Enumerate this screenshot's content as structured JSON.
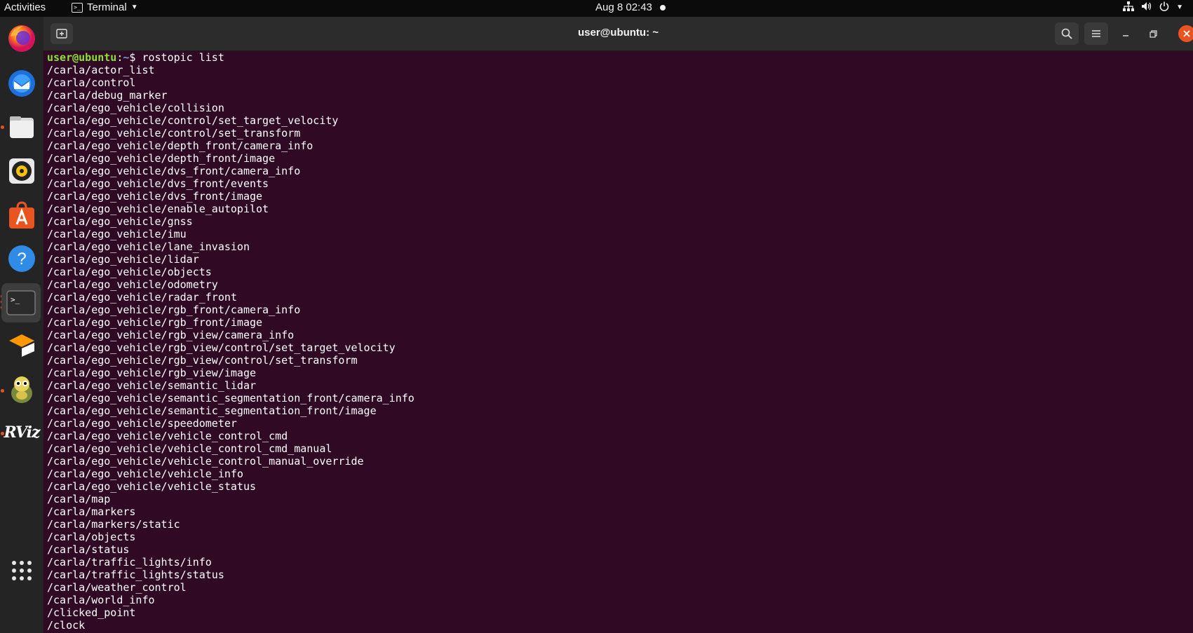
{
  "topbar": {
    "activities": "Activities",
    "app_name": "Terminal",
    "clock": "Aug 8  02:43"
  },
  "dock": {
    "apps": [
      "firefox",
      "thunderbird",
      "files",
      "rhythmbox",
      "app-center",
      "help",
      "terminal",
      "sublime-text",
      "ros-turtle",
      "rviz",
      "show-applications"
    ],
    "rviz_label": "RViz"
  },
  "window": {
    "title": "user@ubuntu: ~"
  },
  "terminal": {
    "prompt_user": "user@ubuntu",
    "prompt_sep": ":",
    "prompt_path": "~",
    "prompt_symbol": "$ ",
    "command": "rostopic list",
    "output": [
      "/carla/actor_list",
      "/carla/control",
      "/carla/debug_marker",
      "/carla/ego_vehicle/collision",
      "/carla/ego_vehicle/control/set_target_velocity",
      "/carla/ego_vehicle/control/set_transform",
      "/carla/ego_vehicle/depth_front/camera_info",
      "/carla/ego_vehicle/depth_front/image",
      "/carla/ego_vehicle/dvs_front/camera_info",
      "/carla/ego_vehicle/dvs_front/events",
      "/carla/ego_vehicle/dvs_front/image",
      "/carla/ego_vehicle/enable_autopilot",
      "/carla/ego_vehicle/gnss",
      "/carla/ego_vehicle/imu",
      "/carla/ego_vehicle/lane_invasion",
      "/carla/ego_vehicle/lidar",
      "/carla/ego_vehicle/objects",
      "/carla/ego_vehicle/odometry",
      "/carla/ego_vehicle/radar_front",
      "/carla/ego_vehicle/rgb_front/camera_info",
      "/carla/ego_vehicle/rgb_front/image",
      "/carla/ego_vehicle/rgb_view/camera_info",
      "/carla/ego_vehicle/rgb_view/control/set_target_velocity",
      "/carla/ego_vehicle/rgb_view/control/set_transform",
      "/carla/ego_vehicle/rgb_view/image",
      "/carla/ego_vehicle/semantic_lidar",
      "/carla/ego_vehicle/semantic_segmentation_front/camera_info",
      "/carla/ego_vehicle/semantic_segmentation_front/image",
      "/carla/ego_vehicle/speedometer",
      "/carla/ego_vehicle/vehicle_control_cmd",
      "/carla/ego_vehicle/vehicle_control_cmd_manual",
      "/carla/ego_vehicle/vehicle_control_manual_override",
      "/carla/ego_vehicle/vehicle_info",
      "/carla/ego_vehicle/vehicle_status",
      "/carla/map",
      "/carla/markers",
      "/carla/markers/static",
      "/carla/objects",
      "/carla/status",
      "/carla/traffic_lights/info",
      "/carla/traffic_lights/status",
      "/carla/weather_control",
      "/carla/world_info",
      "/clicked_point",
      "/clock"
    ]
  },
  "colors": {
    "terminal_bg": "#300a24",
    "prompt_user": "#8ae234",
    "prompt_path": "#729fcf",
    "close_button": "#e95420"
  }
}
